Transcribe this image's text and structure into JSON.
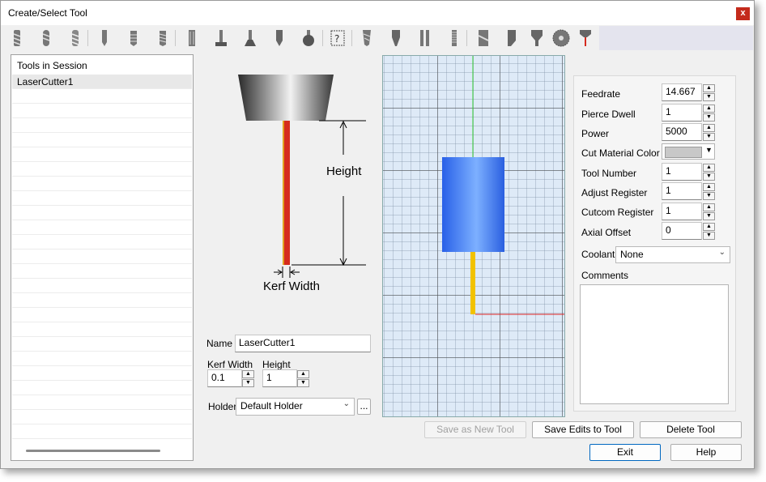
{
  "window": {
    "title": "Create/Select Tool",
    "close_label": "x"
  },
  "toolbar": {
    "icons": [
      "end-mill-icon",
      "ball-mill-icon",
      "bull-mill-icon",
      "drill-icon",
      "tap-icon",
      "thread-mill-icon",
      "reamer-icon",
      "t-slot-icon",
      "dovetail-icon",
      "chamfer-icon",
      "lollipop-icon",
      "custom-tool-icon",
      "taper-mill-icon",
      "engraver-icon",
      "boring-bar-icon",
      "thread-tool-icon",
      "face-mill-icon",
      "plasma-icon",
      "waterjet-icon",
      "saw-blade-icon",
      "laser-icon"
    ]
  },
  "session": {
    "header": "Tools in Session",
    "items": [
      "LaserCutter1"
    ]
  },
  "diagram": {
    "height_label": "Height",
    "kerf_label": "Kerf Width"
  },
  "fields": {
    "name_label": "Name",
    "name_value": "LaserCutter1",
    "kerf_label": "Kerf Width",
    "kerf_value": "0.1",
    "height_label": "Height",
    "height_value": "1",
    "holder_label": "Holder",
    "holder_value": "Default Holder",
    "holder_more": "..."
  },
  "props": {
    "feedrate_label": "Feedrate",
    "feedrate_value": "14.667",
    "pierce_label": "Pierce Dwell",
    "pierce_value": "1",
    "power_label": "Power",
    "power_value": "5000",
    "color_label": "Cut Material Color",
    "color_value": "#c8c8c8",
    "toolnum_label": "Tool Number",
    "toolnum_value": "1",
    "adjust_label": "Adjust Register",
    "adjust_value": "1",
    "cutcom_label": "Cutcom Register",
    "cutcom_value": "1",
    "axial_label": "Axial Offset",
    "axial_value": "0",
    "coolant_label": "Coolant",
    "coolant_value": "None",
    "comments_label": "Comments",
    "comments_value": ""
  },
  "buttons": {
    "save_new": "Save as New Tool",
    "save_edits": "Save Edits to Tool",
    "delete": "Delete Tool",
    "exit": "Exit",
    "help": "Help"
  },
  "colors": {
    "accent": "#0067c0",
    "close": "#c42b1c",
    "laser": "#d52b1e",
    "holder_preview": "#2f6ef0",
    "tool_preview": "#f2c200"
  }
}
